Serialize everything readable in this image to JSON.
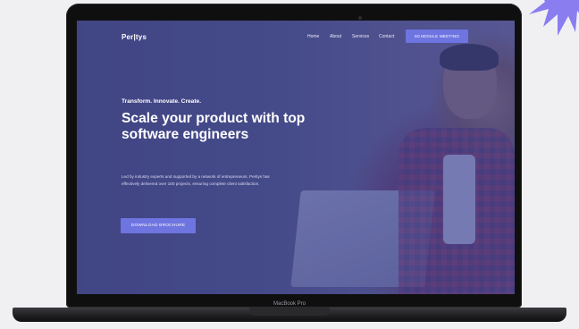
{
  "nav": {
    "logo": "Per|tys",
    "items": [
      "Home",
      "About",
      "Services",
      "Contact"
    ],
    "cta": "SCHEDULE MEETING"
  },
  "hero": {
    "tagline": "Transform. Innovate. Create.",
    "headline": "Scale your product with top software engineers",
    "description": "Led by industry experts and supported by a network of entrepreneurs, Peritys has effectively delivered over 100 projects, ensuring complete client satisfaction.",
    "button": "DOWNLOAD BROCHURE"
  },
  "device": {
    "label": "MacBook Pro"
  },
  "colors": {
    "accent": "#6e74e0",
    "overlay": "#464aa0",
    "burst": "#8a7df0"
  }
}
